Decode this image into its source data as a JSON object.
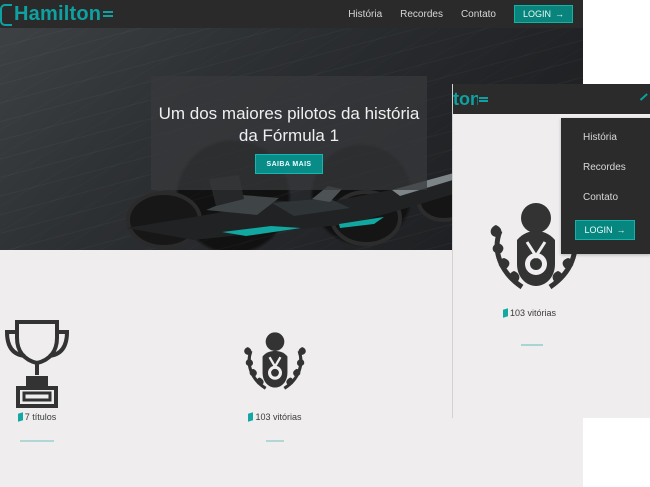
{
  "desktop": {
    "logo": {
      "text": "Hamilton"
    },
    "nav": {
      "items": [
        {
          "label": "História"
        },
        {
          "label": "Recordes"
        },
        {
          "label": "Contato"
        }
      ],
      "login_label": "LOGIN",
      "login_arrow": "→"
    },
    "hero": {
      "title_line_1": "Um dos maiores pilotos da história",
      "title_line_2": "da Fórmula 1",
      "cta_label": "SAIBA MAIS"
    },
    "stats": [
      {
        "label": "7 títulos",
        "icon": "trophy-icon"
      },
      {
        "label": "103 vitórias",
        "icon": "medal-laurel-icon"
      }
    ]
  },
  "mobile": {
    "logo_partial": "ton",
    "menu": {
      "items": [
        {
          "label": "História"
        },
        {
          "label": "Recordes"
        },
        {
          "label": "Contato"
        }
      ],
      "login_label": "LOGIN",
      "login_arrow": "→"
    },
    "stat": {
      "label": "103 vitórias",
      "icon": "medal-laurel-icon"
    }
  },
  "colors": {
    "accent": "#0fa1a1",
    "nav_bg": "#2a2a2a",
    "page_bg": "#efedee",
    "text_dark": "#3b3b3b",
    "button_bg": "#08847c"
  }
}
